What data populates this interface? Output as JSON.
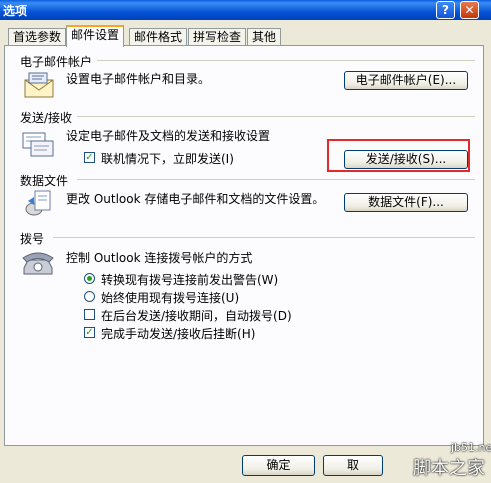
{
  "window": {
    "title": "选项",
    "help_glyph": "?",
    "close_glyph": "✕"
  },
  "tabs": [
    {
      "label": "首选参数"
    },
    {
      "label": "邮件设置",
      "active": true
    },
    {
      "label": "邮件格式"
    },
    {
      "label": "拼写检查"
    },
    {
      "label": "其他"
    }
  ],
  "email_accounts": {
    "heading": "电子邮件帐户",
    "description": "设置电子邮件帐户和目录。",
    "button": "电子邮件帐户(E)..."
  },
  "send_receive": {
    "heading": "发送/接收",
    "description": "设定电子邮件及文档的发送和接收设置",
    "checkbox_label": "联机情况下，立即发送(I)",
    "checkbox_checked": true,
    "button": "发送/接收(S)..."
  },
  "data_files": {
    "heading": "数据文件",
    "description": "更改 Outlook 存储电子邮件和文档的文件设置。",
    "button": "数据文件(F)..."
  },
  "dialup": {
    "heading": "拨号",
    "description": "控制 Outlook 连接拨号帐户的方式",
    "options": [
      {
        "label": "转换现有拨号连接前发出警告(W)",
        "type": "radio",
        "checked": true
      },
      {
        "label": "始终使用现有拨号连接(U)",
        "type": "radio",
        "checked": false
      },
      {
        "label": "在后台发送/接收期间，自动拨号(D)",
        "type": "checkbox",
        "checked": false
      },
      {
        "label": "完成手动发送/接收后挂断(H)",
        "type": "checkbox",
        "checked": true
      }
    ]
  },
  "footer": {
    "ok": "确定",
    "cancel_partial": "取"
  },
  "watermark": {
    "url": "jb51.net",
    "logo": "脚本之家"
  },
  "colors": {
    "highlight": "#E52828",
    "tab_accent": "#F5A623",
    "title_bar": "#0454D8"
  },
  "icons": [
    "mail-envelope-icon",
    "send-receive-icon",
    "data-file-icon",
    "telephone-icon"
  ]
}
